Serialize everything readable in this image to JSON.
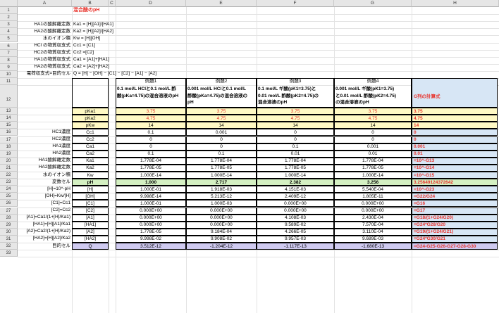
{
  "columns": [
    "A",
    "B",
    "C",
    "D",
    "E",
    "F",
    "G",
    "H"
  ],
  "rows": [
    "1",
    "2",
    "3",
    "4",
    "5",
    "6",
    "7",
    "8",
    "9",
    "10",
    "11",
    "12",
    "13",
    "14",
    "15",
    "16",
    "17",
    "18",
    "19",
    "20",
    "21",
    "22",
    "23",
    "24",
    "25",
    "26",
    "27",
    "28",
    "29",
    "30",
    "31",
    "32",
    "33"
  ],
  "title": "混合酸のpH",
  "defs": [
    {
      "label": "HA1の酸解離定数",
      "formula": "Ka1 = [H][A1]/[HA1]"
    },
    {
      "label": "HA2の酸解離定数",
      "formula": "Ka2 = [H][A2]/[HA2]"
    },
    {
      "label": "水のイオン積",
      "formula": "Kw = [H][OH]"
    },
    {
      "label": "HCl の物質収支式",
      "formula": "Cc1 = [C1]"
    },
    {
      "label": "HC2の物質収支式",
      "formula": "Cc2 =[C2]"
    },
    {
      "label": "HA1の物質収支式",
      "formula": "Ca1 = [A1]+[HA1]"
    },
    {
      "label": "HA2の物質収支式",
      "formula": "Ca2 = [A2]+[HA2]"
    },
    {
      "label": "電荷収支式=目的セル",
      "formula": "Q = [H] − [OH] − [C1] − [C2] − [A1] − [A2]"
    }
  ],
  "examples": [
    {
      "num": "例題1",
      "desc1": "0.1 mol/L HClと0.1 mol/L 酢",
      "desc2": "酸(pKa=4.75)の混合溶液のpH"
    },
    {
      "num": "例題2",
      "desc1": "0.001 mol/L HClと0.1 mol/L",
      "desc2": "酢酸(pKa=4.75)の混合溶液の",
      "desc3": "pH"
    },
    {
      "num": "例題3",
      "desc1": "0.1 mol/L ギ酸(pK1=3.75)と",
      "desc2": "0.01 mol/L 酢酸(pK2=4.75)の",
      "desc3": "混合溶液のpH"
    },
    {
      "num": "例題4",
      "desc1": "0.001 mol/L ギ酸(pK1=3.75)",
      "desc2": "と0.01 mol/L 酢酸(pK2=4.75)",
      "desc3": "の混合溶液のpH"
    }
  ],
  "hhead": "G列の計算式",
  "table": [
    {
      "a": "",
      "b": "pKa1",
      "v": [
        "3.75",
        "3.75",
        "3.75",
        "3.75"
      ],
      "h": "3.75",
      "red": true,
      "bg": "yl"
    },
    {
      "a": "",
      "b": "pKa2",
      "v": [
        "4.75",
        "4.75",
        "4.75",
        "4.75"
      ],
      "h": "4.75",
      "red": true,
      "bg": "yl"
    },
    {
      "a": "",
      "b": "pKw",
      "v": [
        "14",
        "14",
        "14",
        "14"
      ],
      "h": "14",
      "bg": "yl"
    },
    {
      "a": "HC1濃度",
      "b": "Cc1",
      "v": [
        "0.1",
        "0.001",
        "0",
        "0"
      ],
      "h": "0"
    },
    {
      "a": "HC2濃度",
      "b": "Cc2",
      "v": [
        "0",
        "0",
        "0",
        "0"
      ],
      "h": "0"
    },
    {
      "a": "HA1濃度",
      "b": "Ca1",
      "v": [
        "0",
        "0",
        "0.1",
        "0.001"
      ],
      "h": "0.001"
    },
    {
      "a": "HA2濃度",
      "b": "Ca2",
      "v": [
        "0.1",
        "0.1",
        "0.01",
        "0.01"
      ],
      "h": "0.01"
    },
    {
      "a": "HA1酸解離定数",
      "b": "Ka1",
      "v": [
        "1.778E-04",
        "1.778E-04",
        "1.778E-04",
        "1.778E-04"
      ],
      "h": "=10^-G13"
    },
    {
      "a": "HA2酸解離定数",
      "b": "Ka2",
      "v": [
        "1.778E-05",
        "1.778E-05",
        "1.778E-05",
        "1.778E-05"
      ],
      "h": "=10^-G14"
    },
    {
      "a": "水のイオン積",
      "b": "Kw",
      "v": [
        "1.000E-14",
        "1.000E-14",
        "1.000E-14",
        "1.000E-14"
      ],
      "h": "=10^-G15"
    },
    {
      "a": "変数セル",
      "b": "pH",
      "v": [
        "1.000",
        "2.717",
        "2.382",
        "3.256"
      ],
      "h": "3.25649124372642",
      "bg": "gr",
      "bold": true
    },
    {
      "a": "[H]=10^-pH",
      "b": "[H]",
      "v": [
        "1.000E-01",
        "1.918E-03",
        "4.151E-03",
        "5.540E-04"
      ],
      "h": "=10^-G23"
    },
    {
      "a": "[OH]=Kw/[H]",
      "b": "[OH]",
      "v": [
        "9.998E-14",
        "5.213E-12",
        "2.409E-12",
        "1.805E-11"
      ],
      "h": "=G22/G24"
    },
    {
      "a": "[C1]=Cc1",
      "b": "[C1]",
      "v": [
        "1.000E-01",
        "1.000E-03",
        "0.000E+00",
        "0.000E+00"
      ],
      "h": "=G16"
    },
    {
      "a": "[C2]=Cc2",
      "b": "[C2]",
      "v": [
        "0.000E+00",
        "0.000E+00",
        "0.000E+00",
        "0.000E+00"
      ],
      "h": "=G17"
    },
    {
      "a": "[A1]=Ca1/(1+[H]/Ka1)",
      "b": "[A1]",
      "v": [
        "0.000E+00",
        "0.000E+00",
        "4.108E-03",
        "2.430E-04"
      ],
      "h": "=G18/(1+G24/G20)"
    },
    {
      "a": "[HA1]=[H][A1]/Ka1",
      "b": "[HA1]",
      "v": [
        "0.000E+00",
        "0.000E+00",
        "9.589E-02",
        "7.570E-04"
      ],
      "h": "=G24*G28/G20"
    },
    {
      "a": "[A2]=Ca2/(1+[H]/Ka2)",
      "b": "[A2]",
      "v": [
        "1.778E-05",
        "9.184E-04",
        "4.266E-05",
        "3.110E-04"
      ],
      "h": "=G19/(1+G24/G21)"
    },
    {
      "a": "[HA2]=[H][A2]/Ka2",
      "b": "[HA2]",
      "v": [
        "9.998E-02",
        "9.908E-02",
        "9.957E-03",
        "9.689E-03"
      ],
      "h": "=G24*G30/G21"
    },
    {
      "a": "目的セル",
      "b": "Q",
      "v": [
        "3.512E-12",
        "-1.204E-12",
        "-1.117E-13",
        "-1.680E-13"
      ],
      "h": "=G24-G25-G26-G27-G28-G30",
      "bg": "pu"
    }
  ]
}
